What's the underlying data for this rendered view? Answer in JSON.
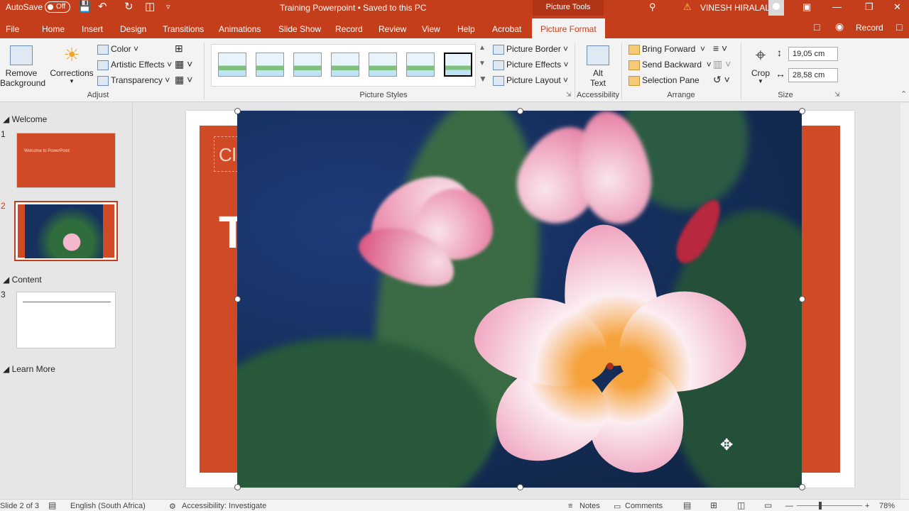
{
  "titlebar": {
    "autosave_label": "AutoSave",
    "autosave_state": "Off",
    "doc_title": "Training Powerpoint • Saved to this PC",
    "context_tab": "Picture Tools",
    "user_name": "VINESH HIRALAL"
  },
  "tabs": [
    "File",
    "Home",
    "Insert",
    "Design",
    "Transitions",
    "Animations",
    "Slide Show",
    "Record",
    "Review",
    "View",
    "Help",
    "Acrobat",
    "Picture Format"
  ],
  "active_tab": "Picture Format",
  "tab_right": {
    "record_label": "Record"
  },
  "ribbon": {
    "adjust": {
      "remove_bg_line1": "Remove",
      "remove_bg_line2": "Background",
      "corrections": "Corrections",
      "color": "Color",
      "artistic_effects": "Artistic Effects",
      "transparency": "Transparency",
      "label": "Adjust"
    },
    "picture_styles": {
      "border": "Picture Border",
      "effects": "Picture Effects",
      "layout": "Picture Layout",
      "label": "Picture Styles"
    },
    "accessibility": {
      "alt_line1": "Alt",
      "alt_line2": "Text",
      "label": "Accessibility"
    },
    "arrange": {
      "bring_forward": "Bring Forward",
      "send_backward": "Send Backward",
      "selection_pane": "Selection Pane",
      "label": "Arrange"
    },
    "size": {
      "crop": "Crop",
      "height": "19,05 cm",
      "width": "28,58 cm",
      "label": "Size"
    }
  },
  "pane": {
    "sections": [
      "Welcome",
      "Content",
      "Learn More"
    ],
    "slides": [
      {
        "num": "1",
        "title": "Welcome to PowerPoint"
      },
      {
        "num": "2"
      },
      {
        "num": "3"
      }
    ]
  },
  "slide": {
    "placeholder_text": "Cl",
    "title_fragment": "T"
  },
  "status": {
    "slide_info": "Slide 2 of 3",
    "language": "English (South Africa)",
    "accessibility": "Accessibility: Investigate",
    "notes": "Notes",
    "comments": "Comments",
    "zoom": "78%"
  },
  "colors": {
    "brand": "#c43e1c",
    "slide_orange": "#d04a25"
  }
}
